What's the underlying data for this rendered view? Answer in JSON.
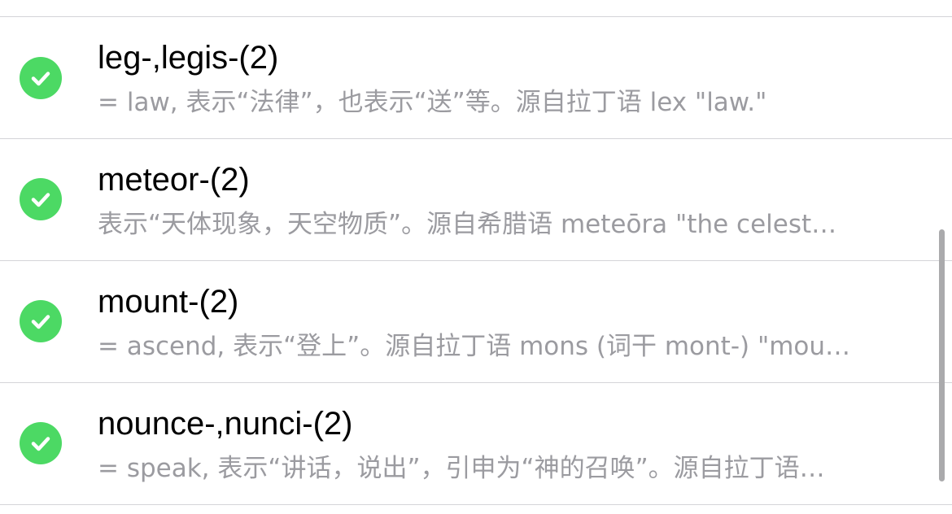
{
  "items": [
    {
      "title": "leg-,legis-(2)",
      "subtitle": "= law, 表示“法律”，也表示“送”等。源自拉丁语 lex \"law.\"",
      "status_icon": "checkmark-circle-icon"
    },
    {
      "title": "meteor-(2)",
      "subtitle": "表示“天体现象，天空物质”。源自希腊语 meteōra \"the celest…",
      "status_icon": "checkmark-circle-icon"
    },
    {
      "title": "mount-(2)",
      "subtitle": "= ascend, 表示“登上”。源自拉丁语 mons (词干 mont-) \"mou…",
      "status_icon": "checkmark-circle-icon"
    },
    {
      "title": "nounce-,nunci-(2)",
      "subtitle": "= speak, 表示“讲话，说出”，引申为“神的召唤”。源自拉丁语…",
      "status_icon": "checkmark-circle-icon"
    }
  ],
  "colors": {
    "check_green": "#4cd964",
    "subtitle_gray": "#9b9ba0",
    "divider": "#d4d4d8"
  }
}
